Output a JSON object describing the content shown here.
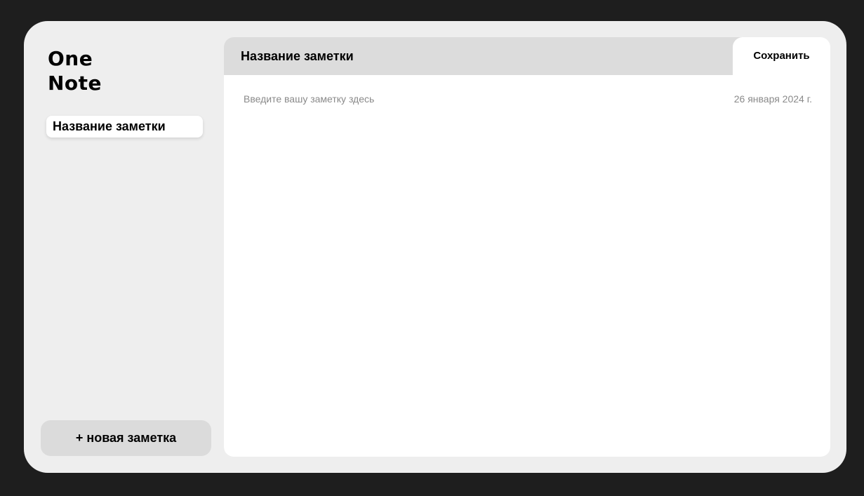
{
  "app": {
    "logo_line1": "One",
    "logo_line2": "Note"
  },
  "sidebar": {
    "notes": [
      {
        "title": "Название заметки"
      }
    ],
    "new_note_label": "+ новая заметка"
  },
  "editor": {
    "title": "Название заметки",
    "save_label": "Сохранить",
    "body_placeholder": "Введите вашу заметку здесь",
    "date": "26 января 2024 г."
  },
  "colors": {
    "background": "#1e1e1e",
    "panel": "#eeeeee",
    "header": "#dcdcdc",
    "surface": "#ffffff",
    "muted_text": "#8a8a8a"
  }
}
